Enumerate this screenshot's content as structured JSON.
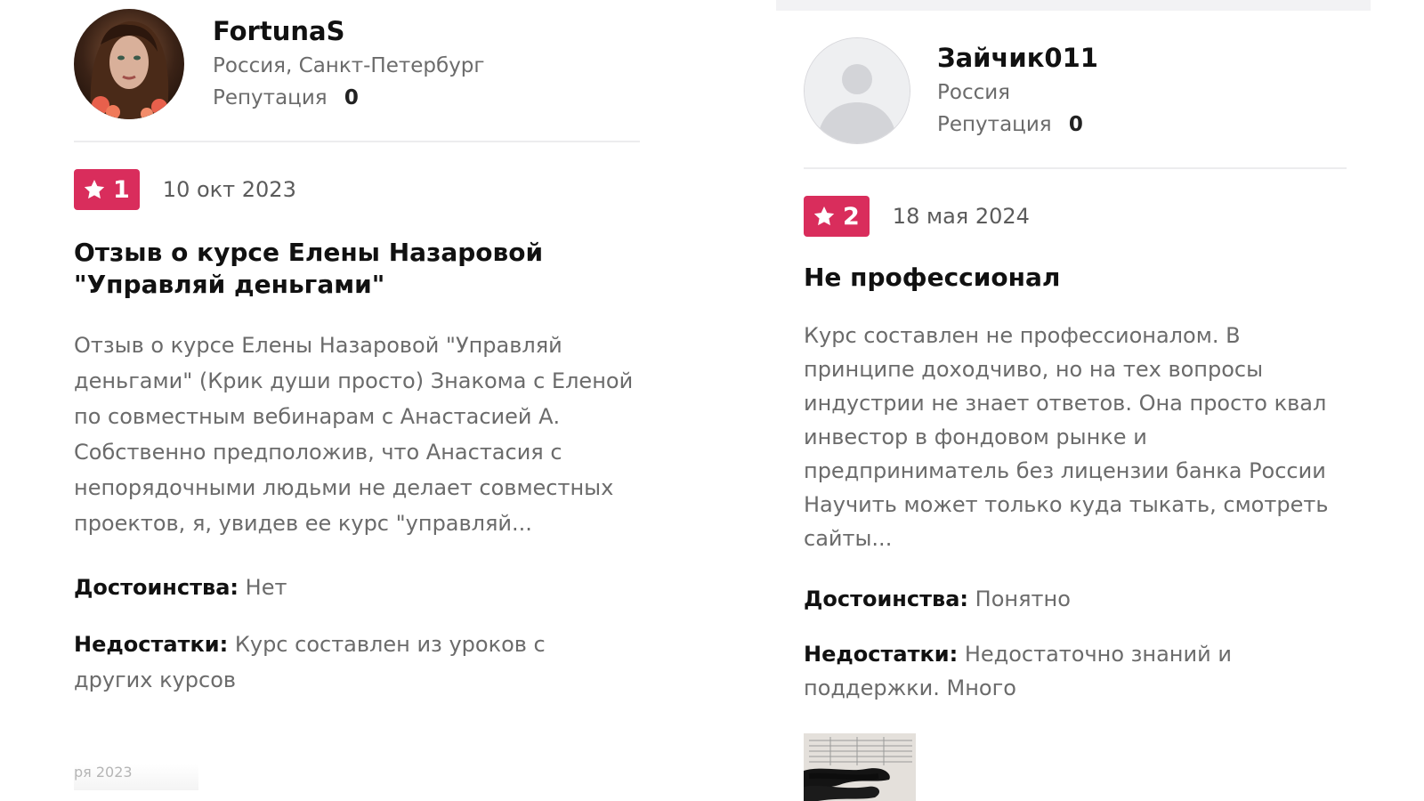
{
  "reviews": [
    {
      "username": "FortunaS",
      "location": "Россия, Санкт-Петербург",
      "reputation_label": "Репутация",
      "reputation_value": "0",
      "rating": "1",
      "date": "10 окт 2023",
      "title": "Отзыв о курсе Елены Назаровой \"Управляй деньгами\"",
      "body": "Отзыв о курсе Елены Назаровой \"Управляй деньгами\" (Крик души просто) Знакома с Еленой по совместным вебинарам с Анастасией А. Собственно предположив, что Анастасия с непорядочными людьми не делает совместных проектов, я, увидев ее курс \"управляй...",
      "pros_label": "Достоинства:",
      "pros": "Нет",
      "cons_label": "Недостатки:",
      "cons": "Курс составлен из уроков с других курсов"
    },
    {
      "username": "Зайчик011",
      "location": "Россия",
      "reputation_label": "Репутация",
      "reputation_value": "0",
      "rating": "2",
      "date": "18 мая 2024",
      "title": "Не профессионал",
      "body": "Курс составлен не профессионалом. В принципе доходчиво, но на тех вопросы индустрии не знает ответов. Она просто квал инвестор в фондовом рынке и предприниматель без лицензии банка России Научить может только куда тыкать, смотреть сайты...",
      "pros_label": "Достоинства:",
      "pros": "Понятно",
      "cons_label": "Недостатки:",
      "cons": "Недостаточно знаний и поддержки. Много"
    }
  ],
  "faded_date": "ря 2023",
  "colors": {
    "rating_badge": "#d92d5c",
    "muted_text": "#6b6b6b",
    "divider": "#ececee"
  },
  "icons": {
    "rating": "star-icon",
    "default_avatar": "user-silhouette-icon"
  }
}
